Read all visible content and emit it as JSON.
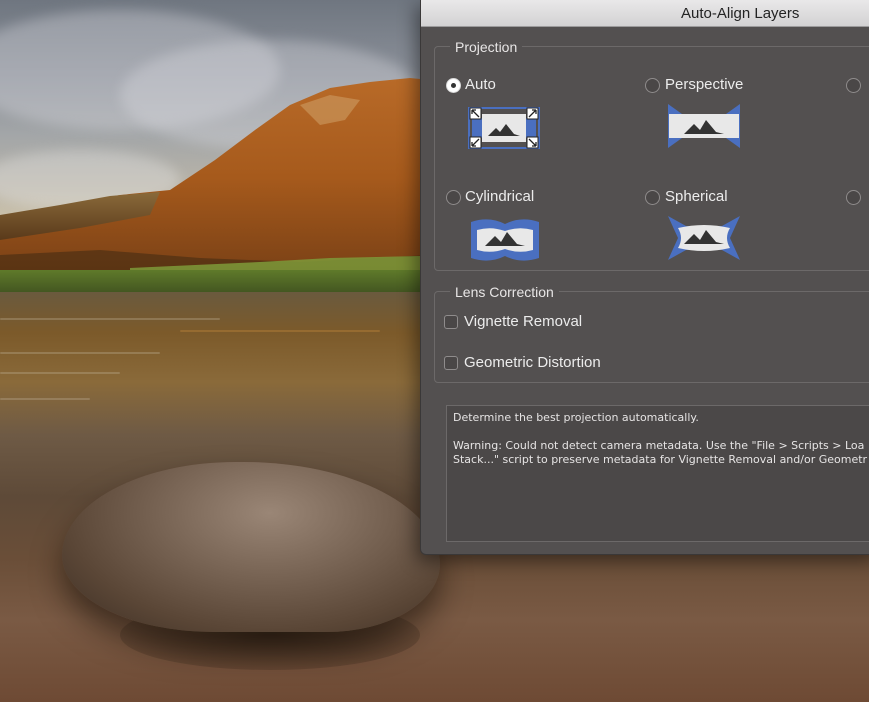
{
  "dialog": {
    "title": "Auto-Align Layers",
    "projection": {
      "label": "Projection",
      "options": [
        {
          "label": "Auto",
          "selected": true
        },
        {
          "label": "Perspective",
          "selected": false
        },
        {
          "label": "Cylindrical",
          "selected": false
        },
        {
          "label": "Spherical",
          "selected": false
        }
      ]
    },
    "lens_correction": {
      "label": "Lens Correction",
      "options": [
        {
          "label": "Vignette Removal",
          "checked": false
        },
        {
          "label": "Geometric Distortion",
          "checked": false
        }
      ]
    },
    "info": {
      "line1": "Determine the best projection automatically.",
      "line2": "Warning: Could not detect camera metadata. Use the \"File > Scripts > Loa",
      "line3": "Stack...\" script to preserve metadata for Vignette Removal and/or Geometr"
    }
  },
  "colors": {
    "dialog_bg": "#535050",
    "icon_blue": "#4a6fc0",
    "icon_frame": "#e8e8e8"
  }
}
